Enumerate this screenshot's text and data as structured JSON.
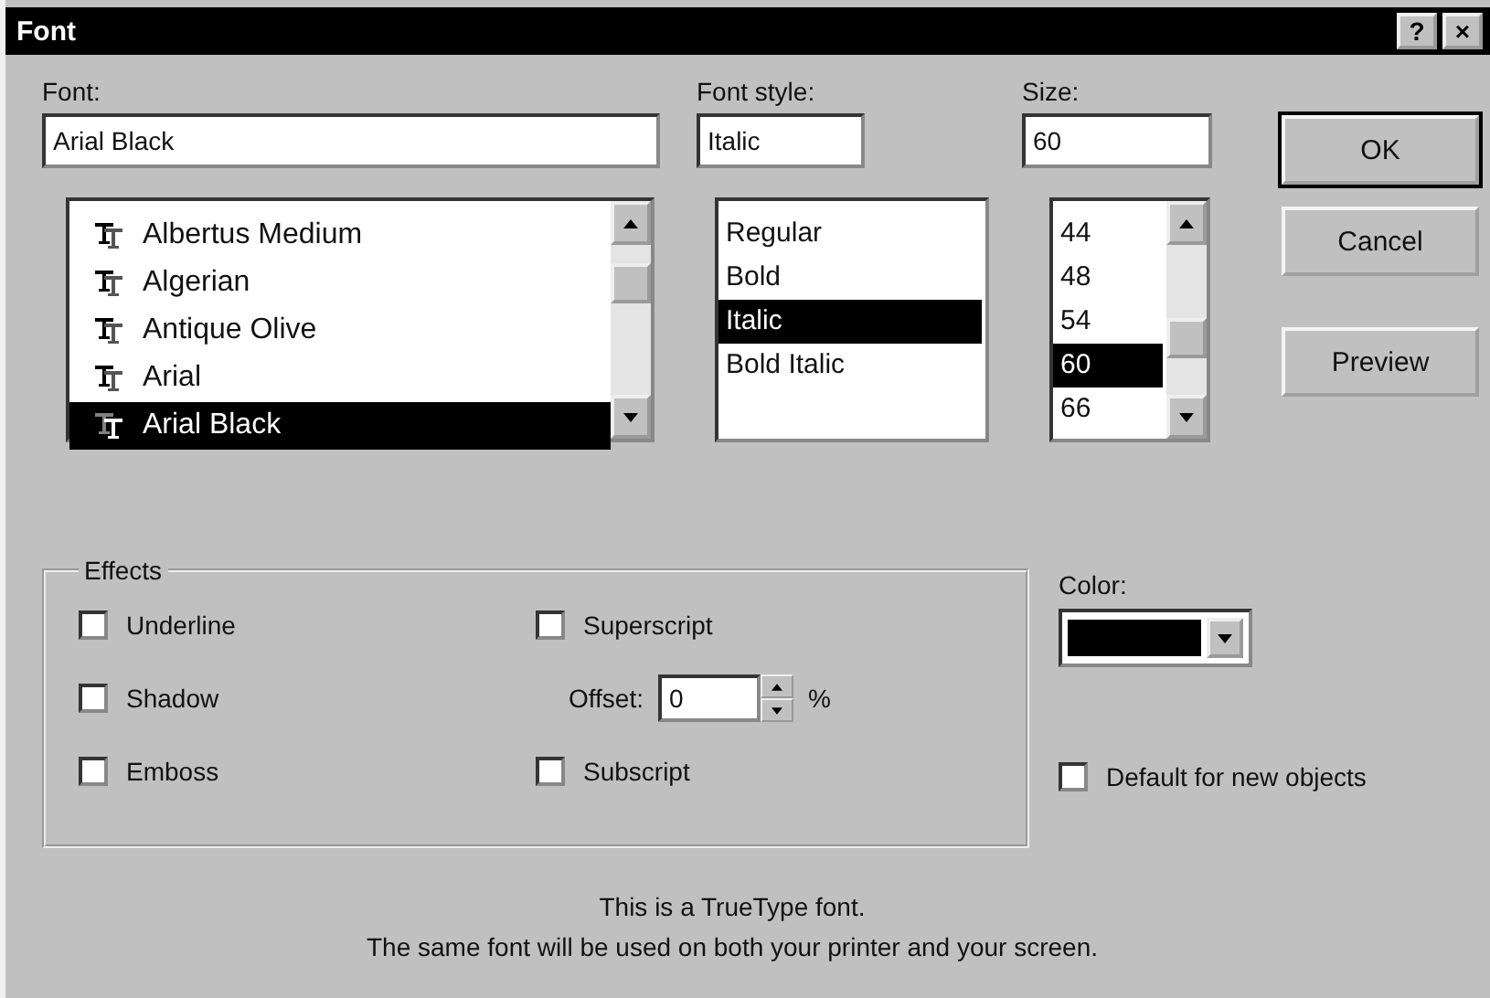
{
  "window": {
    "title": "Font",
    "help_button": "?",
    "close_button": "×"
  },
  "font": {
    "label": "Font:",
    "value": "Arial Black",
    "items": [
      {
        "text": "Albertus Medium",
        "kind": "truetype",
        "selected": false
      },
      {
        "text": "Algerian",
        "kind": "truetype",
        "selected": false
      },
      {
        "text": "Antique Olive",
        "kind": "truetype",
        "selected": false
      },
      {
        "text": "Arial",
        "kind": "truetype",
        "selected": false
      },
      {
        "text": "Arial Black",
        "kind": "truetype",
        "selected": true
      }
    ]
  },
  "font_style": {
    "label": "Font style:",
    "value": "Italic",
    "items": [
      {
        "text": "Regular",
        "selected": false
      },
      {
        "text": "Bold",
        "selected": false
      },
      {
        "text": "Italic",
        "selected": true
      },
      {
        "text": "Bold Italic",
        "selected": false
      }
    ]
  },
  "size": {
    "label": "Size:",
    "value": "60",
    "items": [
      {
        "text": "44",
        "selected": false
      },
      {
        "text": "48",
        "selected": false
      },
      {
        "text": "54",
        "selected": false
      },
      {
        "text": "60",
        "selected": true
      },
      {
        "text": "66",
        "selected": false
      }
    ]
  },
  "buttons": [
    {
      "label": "OK",
      "default": true
    },
    {
      "label": "Cancel",
      "default": false
    },
    {
      "label": "Preview",
      "default": false
    }
  ],
  "effects": {
    "title": "Effects",
    "left": [
      {
        "label": "Underline",
        "checked": false
      },
      {
        "label": "Shadow",
        "checked": false
      },
      {
        "label": "Emboss",
        "checked": false
      }
    ],
    "superscript": {
      "label": "Superscript",
      "checked": false
    },
    "offset": {
      "label": "Offset:",
      "value": "0",
      "unit": "%"
    },
    "subscript": {
      "label": "Subscript",
      "checked": false
    }
  },
  "color": {
    "label": "Color:",
    "color": "#000000"
  },
  "default_checkbox": {
    "label": "Default for new objects",
    "checked": false
  },
  "description": [
    "This is a TrueType font.",
    "The same font will be used on both your printer and your screen."
  ]
}
